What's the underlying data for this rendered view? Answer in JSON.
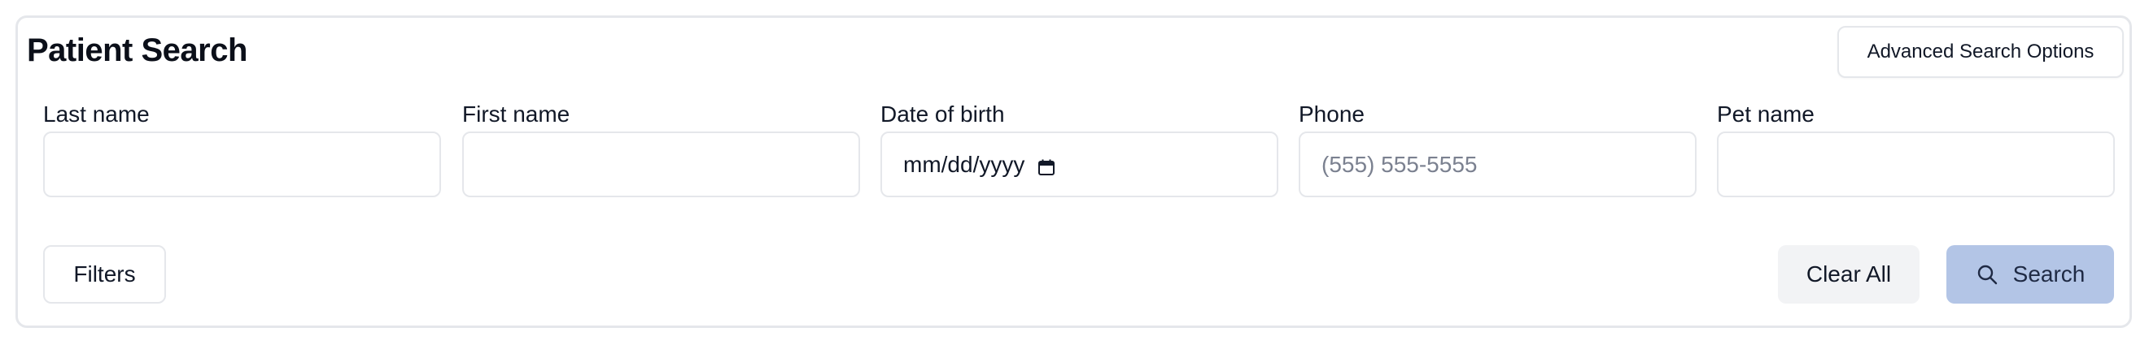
{
  "header": {
    "title": "Patient Search",
    "advanced_label": "Advanced Search Options"
  },
  "fields": {
    "last_name": {
      "label": "Last name",
      "value": "",
      "placeholder": ""
    },
    "first_name": {
      "label": "First name",
      "value": "",
      "placeholder": ""
    },
    "dob": {
      "label": "Date of birth",
      "value": "mm/dd/yyyy"
    },
    "phone": {
      "label": "Phone",
      "value": "",
      "placeholder": "(555) 555-5555"
    },
    "pet_name": {
      "label": "Pet name",
      "value": "",
      "placeholder": ""
    }
  },
  "actions": {
    "filters_label": "Filters",
    "clear_label": "Clear All",
    "search_label": "Search"
  },
  "icons": {
    "calendar": "calendar-icon",
    "search": "search-icon"
  },
  "colors": {
    "search_button_bg": "#b3c5e6",
    "clear_button_bg": "#f2f3f5",
    "border": "#e5e7eb",
    "placeholder": "#7b8190"
  }
}
